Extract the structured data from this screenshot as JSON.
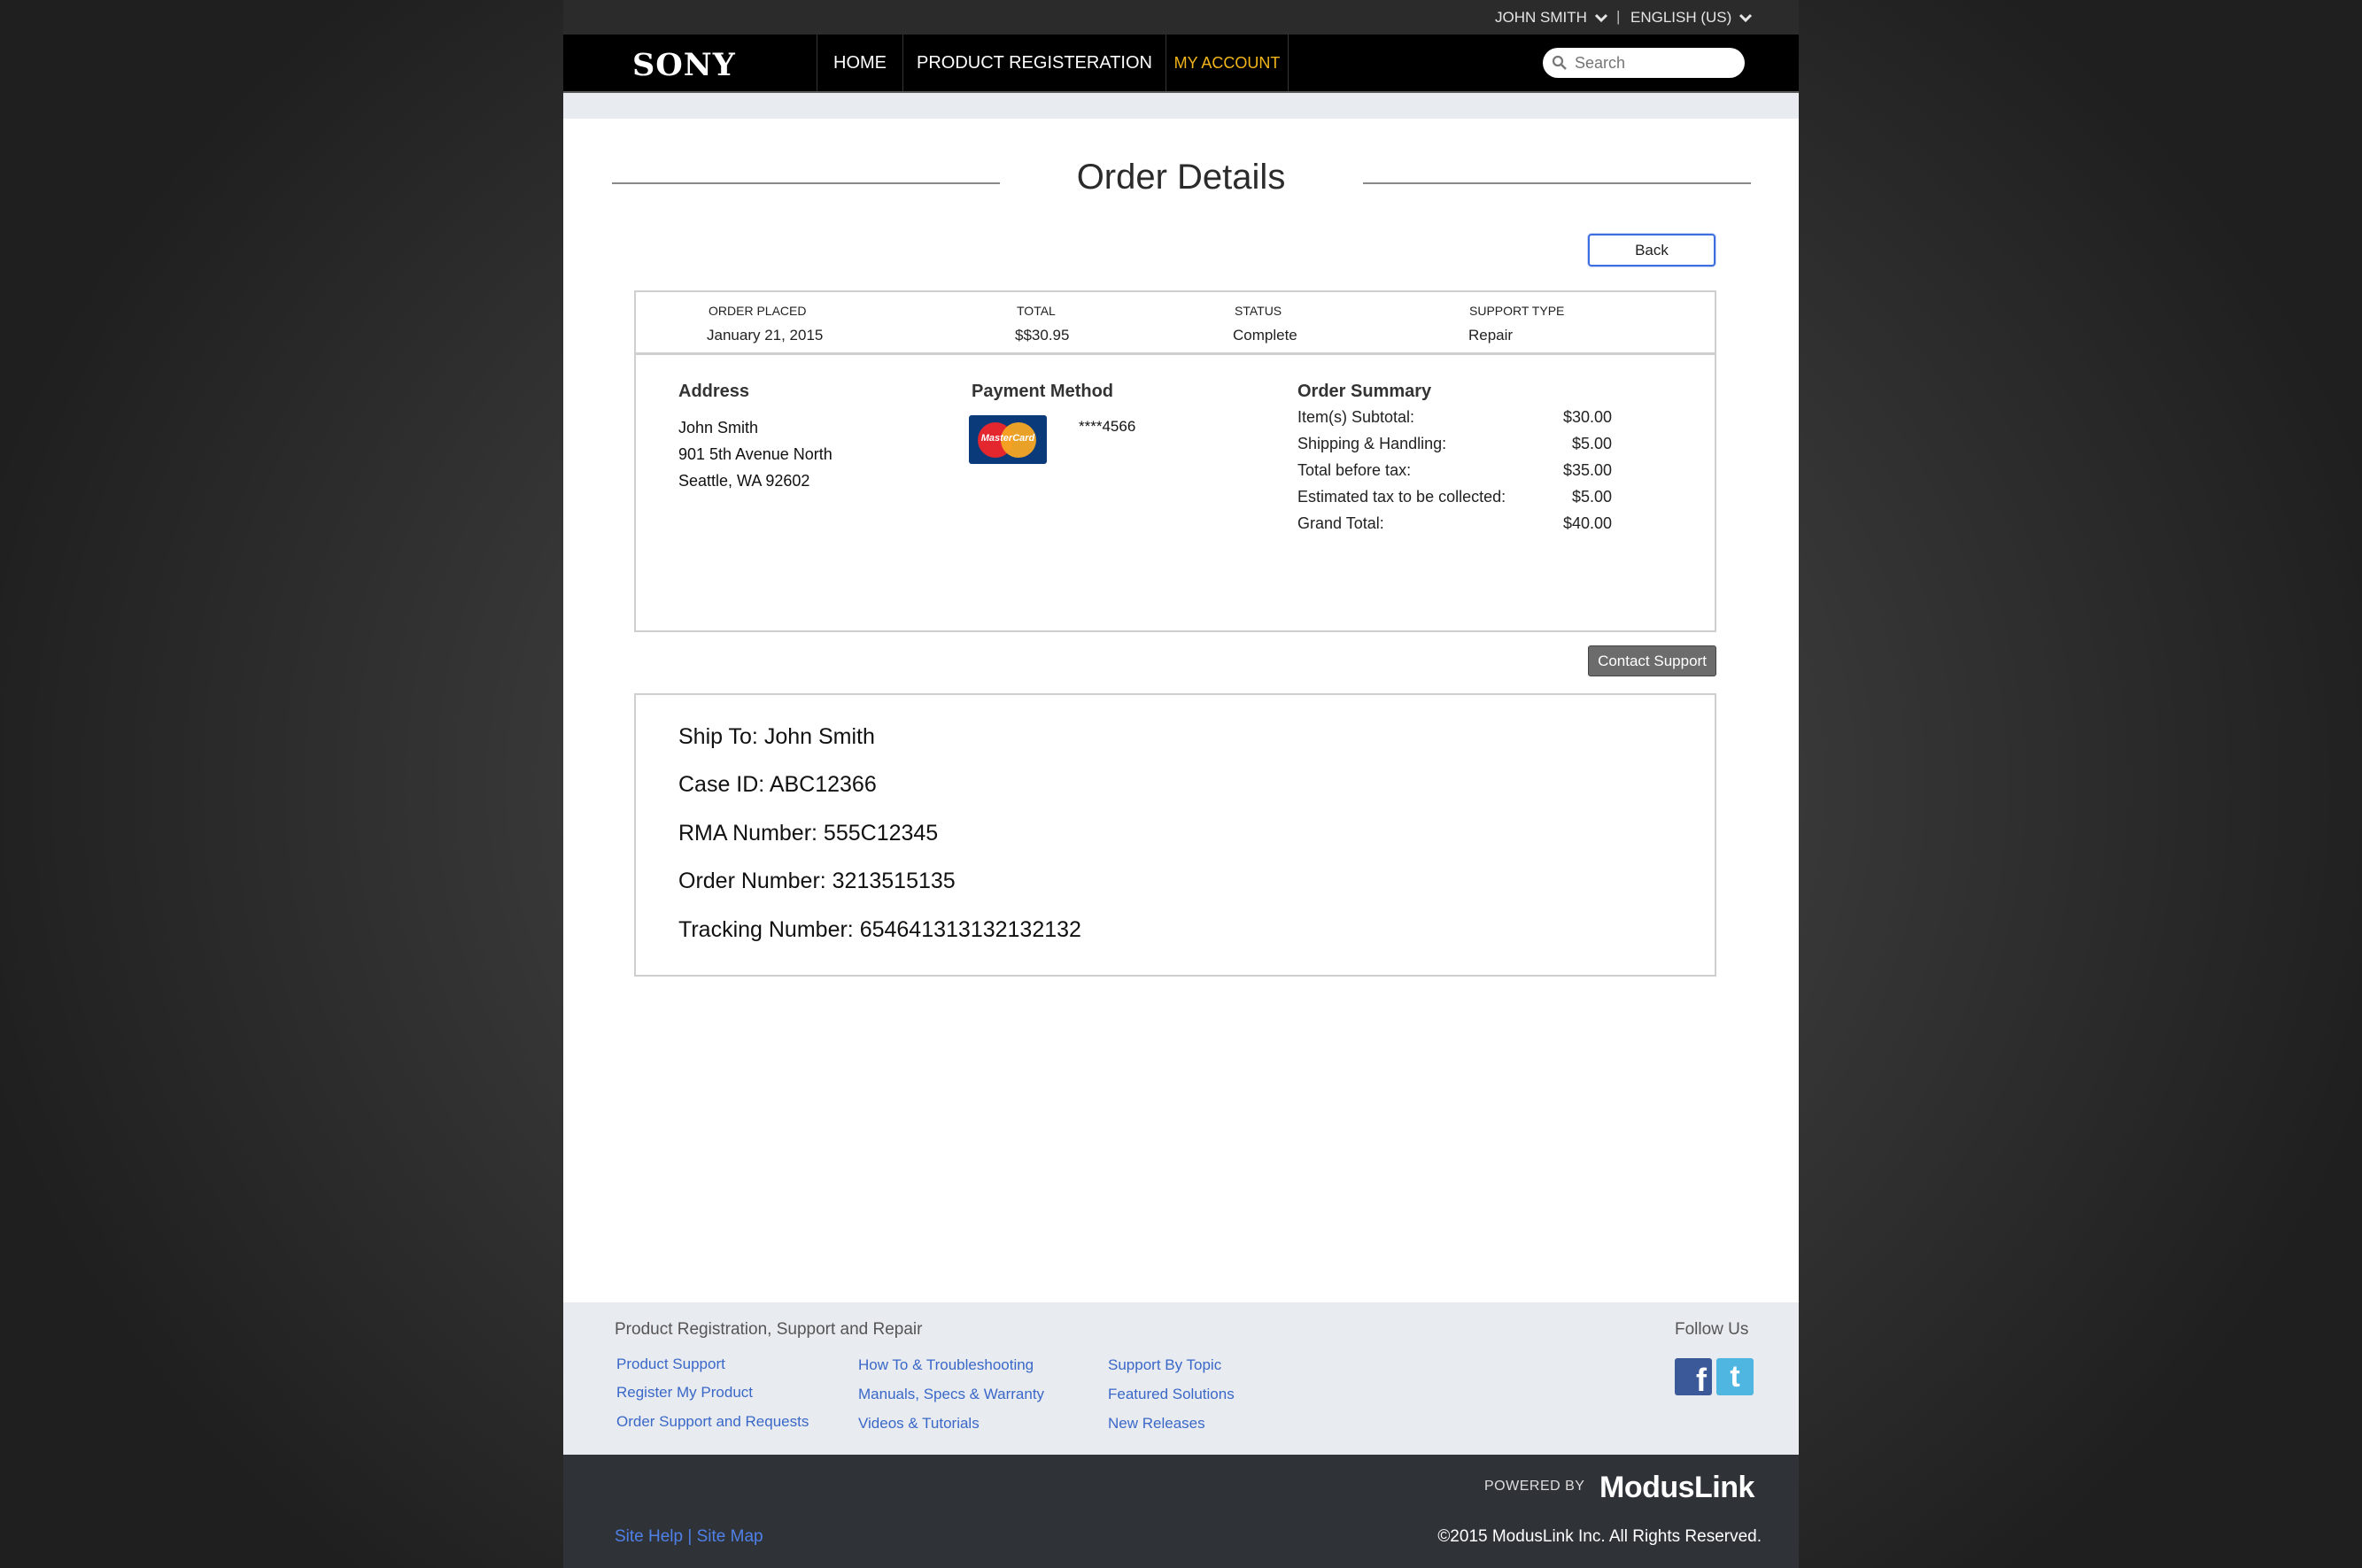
{
  "utility_bar": {
    "user_name": "JOHN SMITH",
    "separator": "|",
    "language": "ENGLISH (US)"
  },
  "nav": {
    "logo": "SONY",
    "items": [
      {
        "label": "HOME",
        "active": false
      },
      {
        "label": "PRODUCT REGISTERATION",
        "active": false
      },
      {
        "label": "MY ACCOUNT",
        "active": true
      }
    ],
    "search_placeholder": "Search"
  },
  "page": {
    "title": "Order Details",
    "back_label": "Back",
    "contact_support_label": "Contact Support"
  },
  "order_header": {
    "columns": [
      {
        "label": "ORDER PLACED",
        "value": "January 21, 2015"
      },
      {
        "label": "TOTAL",
        "value": "$$30.95"
      },
      {
        "label": "STATUS",
        "value": "Complete"
      },
      {
        "label": "SUPPORT TYPE",
        "value": "Repair"
      }
    ]
  },
  "address": {
    "title": "Address",
    "lines": [
      "John Smith",
      "901 5th Avenue North",
      "Seattle, WA 92602"
    ]
  },
  "payment": {
    "title": "Payment Method",
    "card_brand": "MasterCard",
    "card_number": "****4566"
  },
  "order_summary": {
    "title": "Order Summary",
    "rows": [
      {
        "label": "Item(s) Subtotal:",
        "value": "$30.00"
      },
      {
        "label": "Shipping & Handling:",
        "value": "$5.00"
      },
      {
        "label": "Total before tax:",
        "value": "$35.00"
      },
      {
        "label": "Estimated tax to be collected:",
        "value": "$5.00"
      },
      {
        "label": "Grand Total:",
        "value": "$40.00"
      }
    ]
  },
  "shipping": {
    "lines": [
      "Ship To: John Smith",
      "Case ID: ABC12366",
      "RMA Number: 555C12345",
      "Order Number: 3213515135",
      "Tracking Number: 654641313132132132"
    ]
  },
  "footer": {
    "title": "Product Registration, Support and Repair",
    "col1": [
      "Product Support",
      "Register My Product",
      "Order Support and Requests"
    ],
    "col2": [
      "How To & Troubleshooting",
      "Manuals, Specs & Warranty",
      "Videos & Tutorials"
    ],
    "col3": [
      "Support By Topic",
      "Featured Solutions",
      "New Releases"
    ],
    "follow_us": "Follow Us",
    "facebook_glyph": "f",
    "twitter_glyph": "t",
    "powered_by": "POWERED BY",
    "brand": "ModusLink",
    "site_help": "Site Help",
    "link_sep": "|",
    "site_map": "Site Map",
    "copyright": "©2015 ModusLink Inc. All Rights Reserved."
  },
  "colors": {
    "accent": "#f3b51b",
    "link": "#3a68c8",
    "nav_bg": "#000000",
    "footer_dark": "#2f3338"
  }
}
